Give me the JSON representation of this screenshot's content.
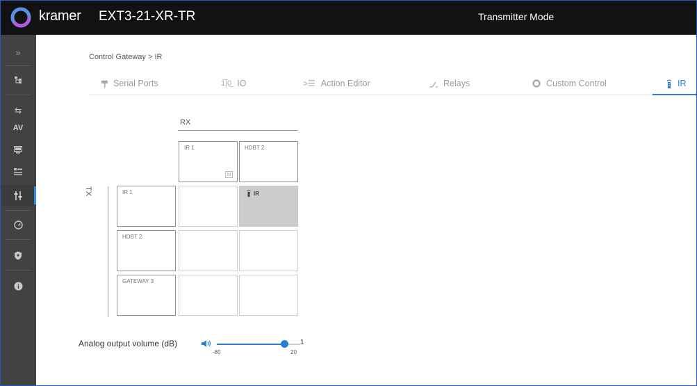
{
  "header": {
    "brand": "kramer",
    "device_name": "EXT3-21-XR-TR",
    "mode": "Transmitter Mode"
  },
  "sidebar": {
    "items": [
      {
        "icon": "expand-icon",
        "glyph": "»"
      },
      {
        "icon": "network-icon",
        "glyph": "⊞"
      },
      {
        "icon": "auto-switch-icon",
        "glyph": "⇆"
      },
      {
        "icon": "av-icon",
        "glyph": "AV"
      },
      {
        "icon": "display-icon",
        "glyph": "▭"
      },
      {
        "icon": "settings-list-icon",
        "glyph": "☰"
      },
      {
        "icon": "control-gateway-icon",
        "glyph": "⫶",
        "active": true
      },
      {
        "icon": "diagnostics-icon",
        "glyph": "◴"
      },
      {
        "icon": "security-shield-icon",
        "glyph": "⛊"
      },
      {
        "icon": "info-icon",
        "glyph": "i"
      }
    ]
  },
  "breadcrumb": "Control Gateway  >  IR",
  "tabs": [
    {
      "label": "Serial Ports",
      "icon": "serial-port-icon"
    },
    {
      "label": "IO",
      "icon": "io-icon"
    },
    {
      "label": "Action Editor",
      "icon": "action-editor-icon"
    },
    {
      "label": "Relays",
      "icon": "relay-icon"
    },
    {
      "label": "Custom Control",
      "icon": "custom-control-icon"
    },
    {
      "label": "IR",
      "icon": "ir-remote-icon",
      "active": true
    }
  ],
  "matrix": {
    "rx_label": "RX",
    "tx_label": "TX",
    "rx_ports": [
      "IR 1",
      "HDBT 2"
    ],
    "tx_ports": [
      "IR 1",
      "HDBT 2",
      "GATEWAY 3"
    ],
    "m_badge": "M",
    "active_route": {
      "tx": "IR 1",
      "rx": "HDBT 2",
      "label": "IR"
    }
  },
  "volume": {
    "label": "Analog output volume (dB)",
    "min": "-80",
    "max": "20",
    "value": "1",
    "level": 0.81
  },
  "colors": {
    "accent": "#2a7fd4",
    "header_bg": "#121212",
    "sidebar_bg": "#424242",
    "active_cell": "#cccccc"
  }
}
